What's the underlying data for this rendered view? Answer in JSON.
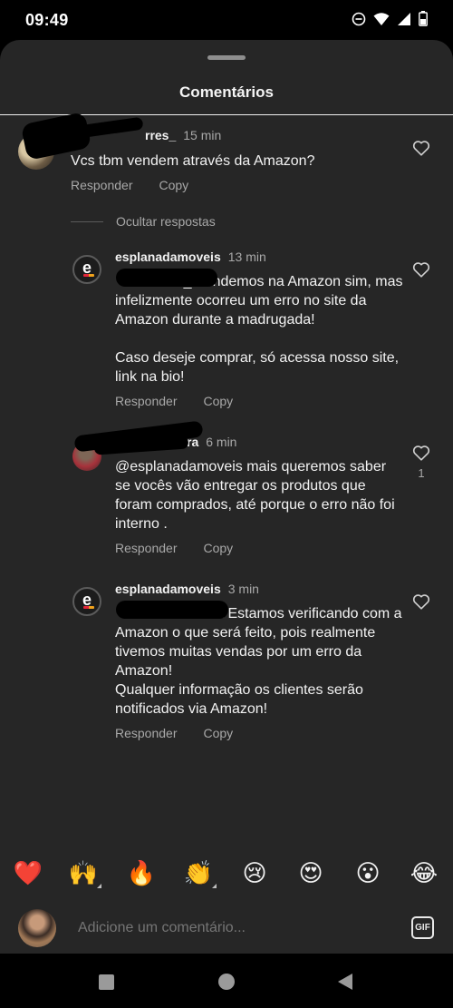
{
  "status_bar": {
    "time": "09:49"
  },
  "sheet": {
    "title": "Comentários"
  },
  "comments": [
    {
      "author": "rres_",
      "time": "15 min",
      "text": "Vcs tbm vendem através da Amazon?",
      "reply_label": "Responder",
      "copy_label": "Copy"
    }
  ],
  "replies_toggle": "Ocultar respostas",
  "replies": [
    {
      "author": "esplanadamoveis",
      "time": "13 min",
      "text": "            res_ Vendemos na Amazon sim, mas infelizmente ocorreu um erro no site da Amazon durante a madrugada!\n\nCaso deseje comprar, só acessa nosso site, link na bio!",
      "reply_label": "Responder",
      "copy_label": "Copy"
    },
    {
      "author": "ra",
      "time": "6 min",
      "text": "@esplanadamoveis mais queremos saber se vocês vão entregar os produtos que foram comprados, até porque o erro não foi interno .",
      "likes": "1",
      "reply_label": "Responder",
      "copy_label": "Copy"
    },
    {
      "author": "esplanadamoveis",
      "time": "3 min",
      "text": "                         a Estamos verificando com a Amazon o que será feito, pois realmente tivemos muitas vendas por um erro da Amazon!\nQualquer informação os clientes serão notificados via Amazon!",
      "reply_label": "Responder",
      "copy_label": "Copy"
    }
  ],
  "emoji_bar": [
    "❤️",
    "🙌",
    "🔥",
    "👏",
    "😢",
    "😍",
    "😮",
    "😂"
  ],
  "composer": {
    "placeholder": "Adicione um comentário...",
    "gif_label": "GIF"
  },
  "colors": {
    "background": "#262626",
    "text": "#f2f2f2",
    "muted": "#a8a8a8"
  }
}
